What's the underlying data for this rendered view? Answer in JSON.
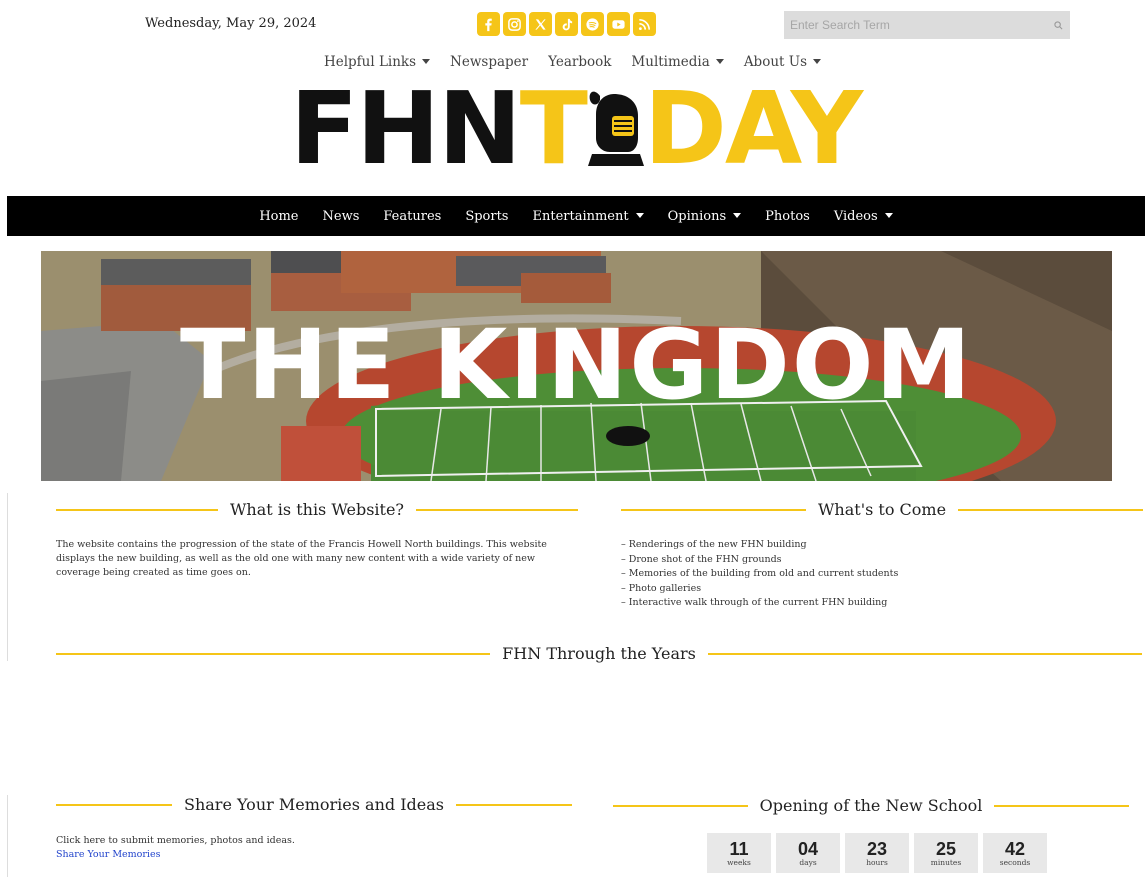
{
  "header": {
    "date": "Wednesday, May 29, 2024",
    "social": [
      {
        "name": "facebook-icon"
      },
      {
        "name": "instagram-icon"
      },
      {
        "name": "x-icon"
      },
      {
        "name": "tiktok-icon"
      },
      {
        "name": "spotify-icon"
      },
      {
        "name": "youtube-icon"
      },
      {
        "name": "rss-icon"
      }
    ],
    "search": {
      "placeholder": "Enter Search Term"
    }
  },
  "topnav": {
    "items": [
      "Helpful Links",
      "Newspaper",
      "Yearbook",
      "Multimedia",
      "About Us"
    ]
  },
  "logo": {
    "part1": "FHN",
    "part2": "T",
    "part3": "DAY"
  },
  "mainnav": {
    "items": [
      "Home",
      "News",
      "Features",
      "Sports",
      "Entertainment",
      "Opinions",
      "Photos",
      "Videos"
    ]
  },
  "hero": {
    "title": "THE KINGDOM"
  },
  "sections": {
    "website": {
      "title": "What is this Website?",
      "body": "The website contains the progression of the state of the Francis Howell North buildings. This website displays the new building, as well as the old one with many new content with a wide variety of new coverage being created as time goes on."
    },
    "to_come": {
      "title": "What's to Come",
      "items": [
        "– Renderings of the new FHN building",
        "– Drone shot of the FHN grounds",
        "– Memories of the building from old and current students",
        "– Photo galleries",
        "– Interactive walk through of the current FHN building"
      ]
    },
    "through_years": {
      "title": "FHN Through the Years"
    },
    "memories": {
      "title": "Share Your Memories and Ideas",
      "body": "Click here to submit memories, photos and ideas.",
      "link": "Share Your Memories"
    },
    "opening": {
      "title": "Opening of the New School",
      "countdown": [
        {
          "value": "11",
          "label": "weeks"
        },
        {
          "value": "04",
          "label": "days"
        },
        {
          "value": "23",
          "label": "hours"
        },
        {
          "value": "25",
          "label": "minutes"
        },
        {
          "value": "42",
          "label": "seconds"
        }
      ]
    }
  },
  "colors": {
    "accent": "#f5c518",
    "nav_bg": "#000000",
    "link": "#2244cc"
  }
}
